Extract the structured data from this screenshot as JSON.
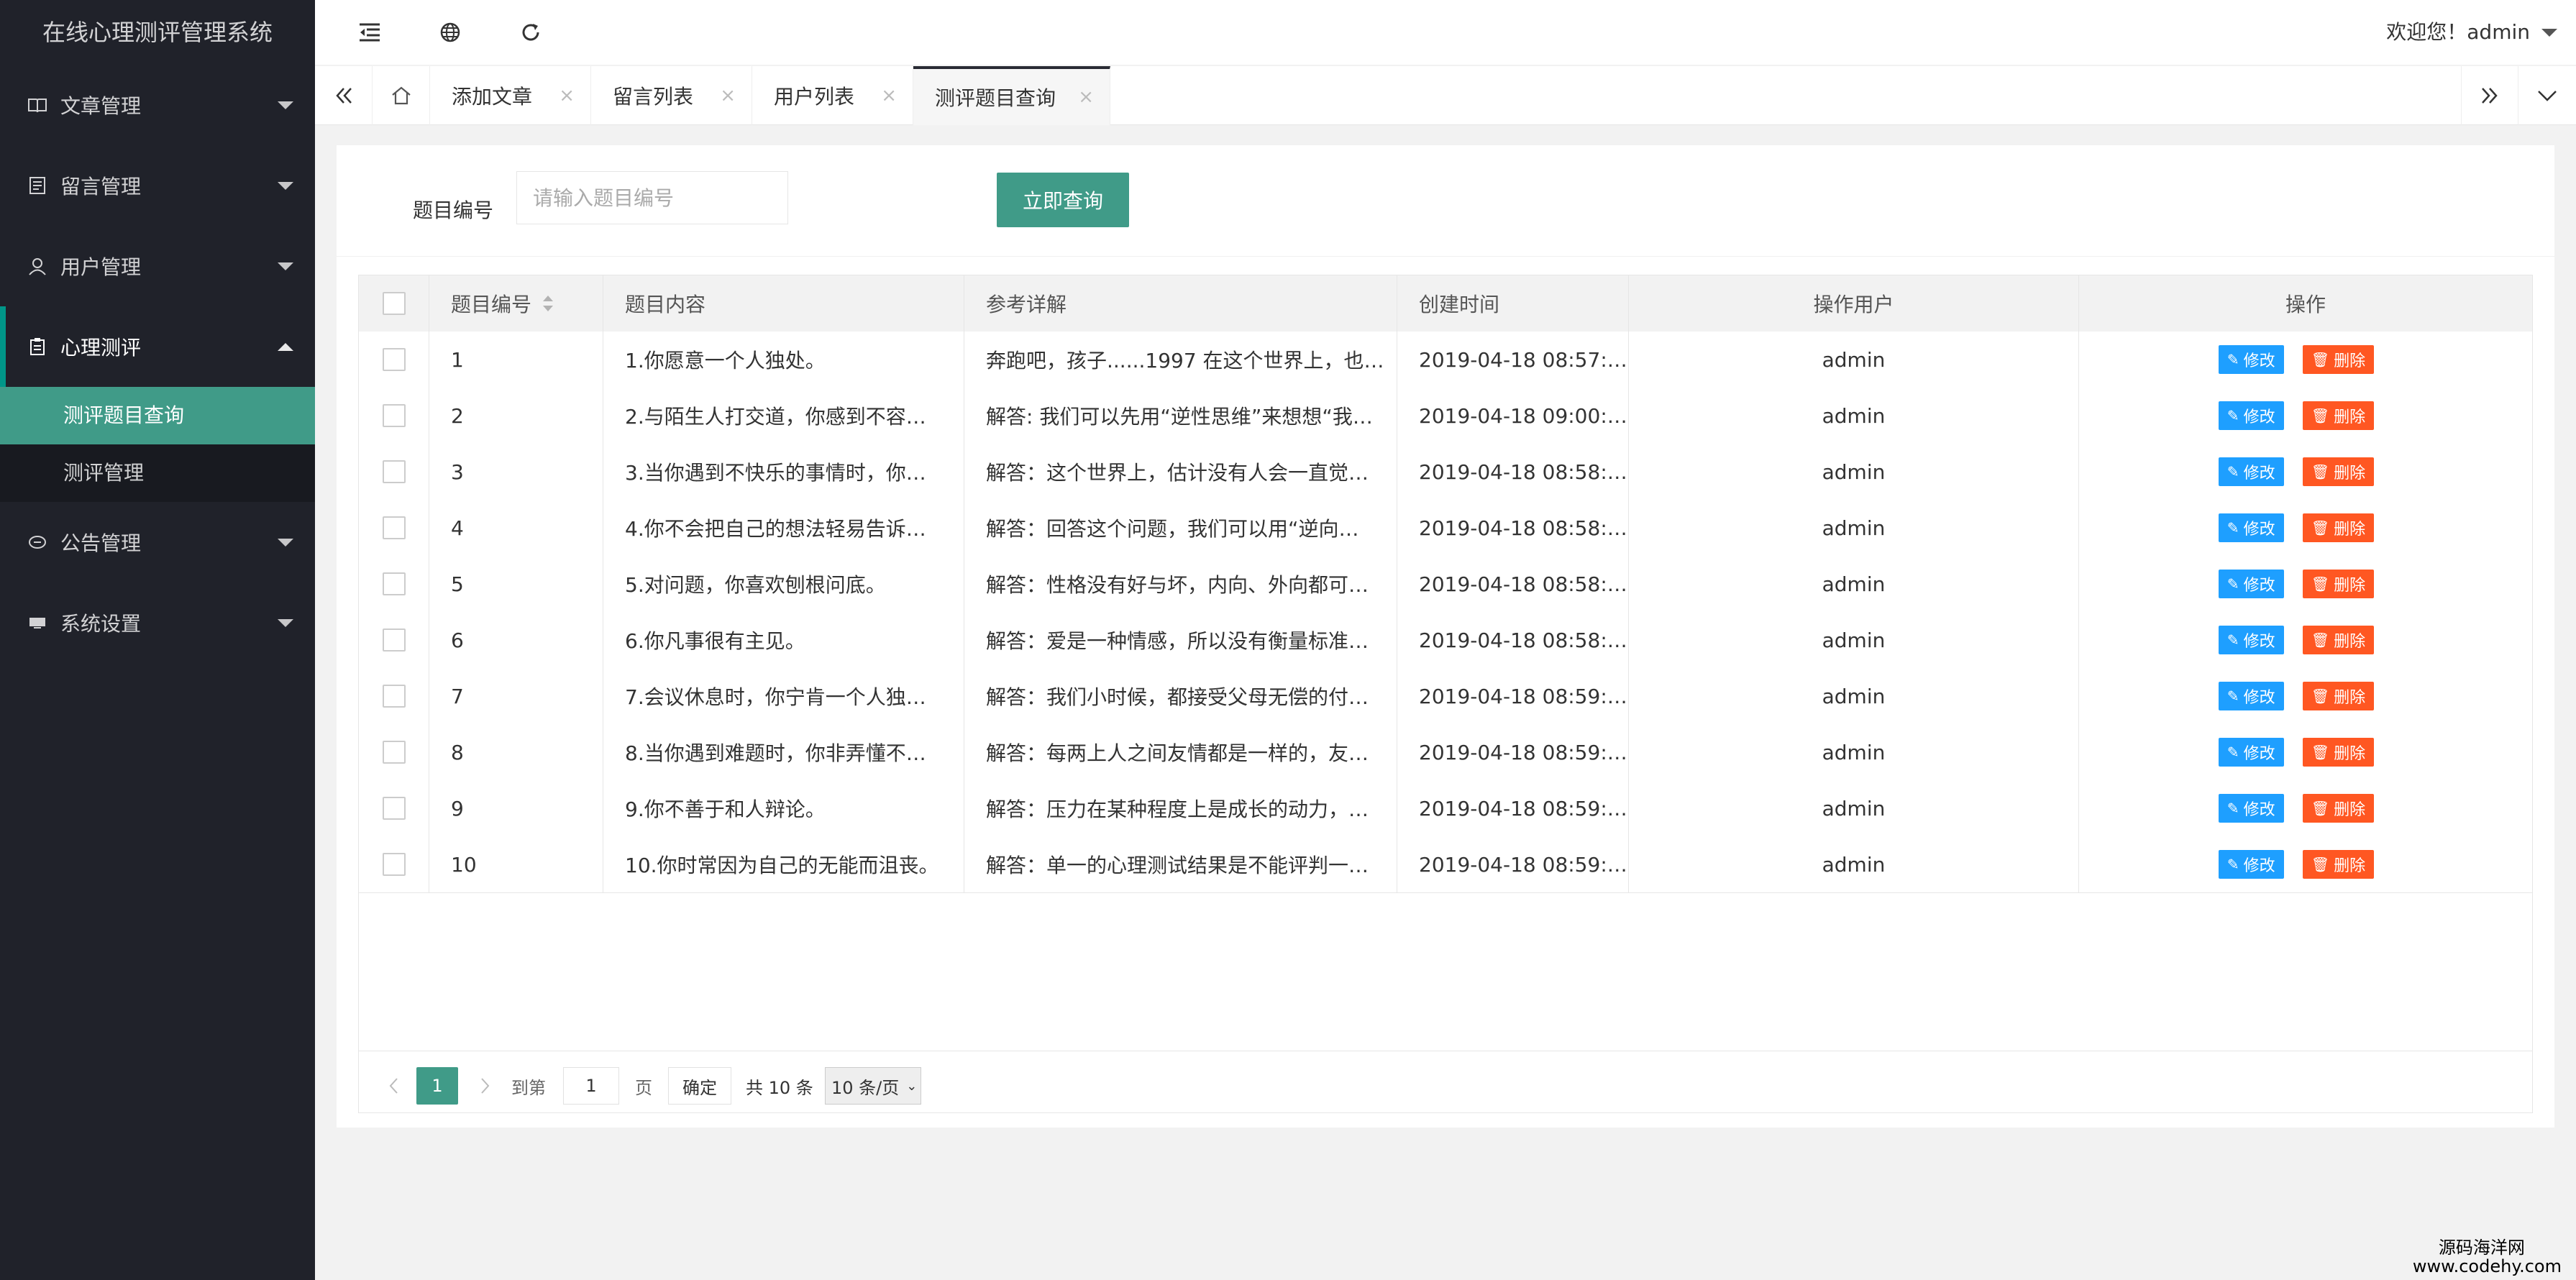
{
  "app": {
    "title": "在线心理测评管理系统"
  },
  "sidebar": {
    "items": [
      {
        "label": "文章管理",
        "icon": "book-icon",
        "expanded": false
      },
      {
        "label": "留言管理",
        "icon": "message-icon",
        "expanded": false
      },
      {
        "label": "用户管理",
        "icon": "user-icon",
        "expanded": false
      },
      {
        "label": "心理测评",
        "icon": "clipboard-icon",
        "expanded": true,
        "children": [
          {
            "label": "测评题目查询",
            "active": true
          },
          {
            "label": "测评管理",
            "active": false
          }
        ]
      },
      {
        "label": "公告管理",
        "icon": "announce-icon",
        "expanded": false
      },
      {
        "label": "系统设置",
        "icon": "settings-icon",
        "expanded": false
      }
    ]
  },
  "header": {
    "welcome": "欢迎您！admin",
    "icons": [
      "menu-fold-icon",
      "globe-icon",
      "refresh-icon"
    ]
  },
  "tabs": [
    {
      "label": "添加文章"
    },
    {
      "label": "留言列表"
    },
    {
      "label": "用户列表"
    },
    {
      "label": "测评题目查询",
      "active": true
    }
  ],
  "search": {
    "label": "题目编号",
    "placeholder": "请输入题目编号",
    "value": "",
    "button": "立即查询"
  },
  "table": {
    "columns": [
      "题目编号",
      "题目内容",
      "参考详解",
      "创建时间",
      "操作用户",
      "操作"
    ],
    "edit_label": "修改",
    "delete_label": "删除",
    "rows": [
      {
        "id": "1",
        "content": "1.你愿意一个人独处。",
        "detail": "奔跑吧，孩子......1997 在这个世界上，也…",
        "time": "2019-04-18 08:57:…",
        "user": "admin"
      },
      {
        "id": "2",
        "content": "2.与陌生人打交道，你感到不容…",
        "detail": "解答: 我们可以先用“逆性思维”来想想“我…",
        "time": "2019-04-18 09:00:…",
        "user": "admin"
      },
      {
        "id": "3",
        "content": "3.当你遇到不快乐的事情时，你…",
        "detail": "解答：这个世界上，估计没有人会一直觉…",
        "time": "2019-04-18 08:58:…",
        "user": "admin"
      },
      {
        "id": "4",
        "content": "4.你不会把自己的想法轻易告诉…",
        "detail": "解答：回答这个问题，我们可以用“逆向…",
        "time": "2019-04-18 08:58:…",
        "user": "admin"
      },
      {
        "id": "5",
        "content": "5.对问题，你喜欢刨根问底。",
        "detail": "解答：性格没有好与坏，内向、外向都可…",
        "time": "2019-04-18 08:58:…",
        "user": "admin"
      },
      {
        "id": "6",
        "content": "6.你凡事很有主见。",
        "detail": "解答：爱是一种情感，所以没有衡量标准…",
        "time": "2019-04-18 08:58:…",
        "user": "admin"
      },
      {
        "id": "7",
        "content": "7.会议休息时，你宁肯一个人独…",
        "detail": "解答：我们小时候，都接受父母无偿的付…",
        "time": "2019-04-18 08:59:…",
        "user": "admin"
      },
      {
        "id": "8",
        "content": "8.当你遇到难题时，你非弄懂不…",
        "detail": "解答：每两上人之间友情都是一样的，友…",
        "time": "2019-04-18 08:59:…",
        "user": "admin"
      },
      {
        "id": "9",
        "content": "9.你不善于和人辩论。",
        "detail": "解答：压力在某种程度上是成长的动力，…",
        "time": "2019-04-18 08:59:…",
        "user": "admin"
      },
      {
        "id": "10",
        "content": "10.你时常因为自己的无能而沮丧。",
        "detail": "解答：单一的心理测试结果是不能评判一…",
        "time": "2019-04-18 08:59:…",
        "user": "admin"
      }
    ]
  },
  "pagination": {
    "current": "1",
    "goto_label": "到第",
    "goto_value": "1",
    "page_label": "页",
    "confirm": "确定",
    "total": "共 10 条",
    "per_page": "10 条/页"
  },
  "watermark": {
    "line1": "源码海洋网",
    "line2": "www.codehy.com"
  },
  "colors": {
    "sidebar": "#20222a",
    "accent": "#409b88",
    "edit": "#1e9fff",
    "delete": "#ff5722"
  }
}
